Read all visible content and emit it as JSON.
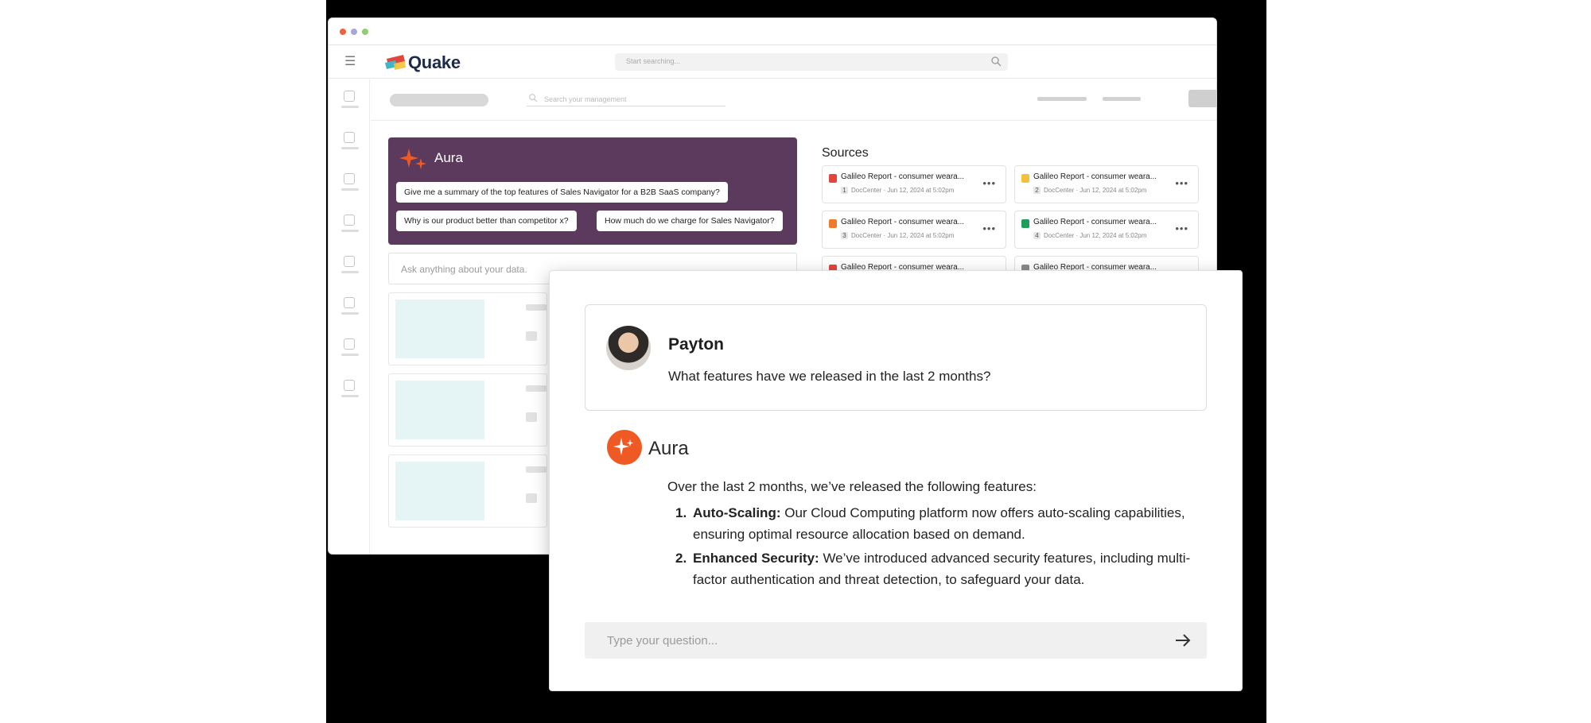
{
  "app": {
    "name": "Quake",
    "top_search_placeholder": "Start searching...",
    "sub_search_placeholder": "Search your management"
  },
  "aura_card": {
    "title": "Aura",
    "prompts": [
      "Give me a summary of the top features of Sales Navigator for a B2B SaaS company?",
      "Why is our product better than competitor x?",
      "How much do we charge for Sales Navigator?"
    ],
    "ask_placeholder": "Ask anything about your data."
  },
  "sources": {
    "title": "Sources",
    "items": [
      {
        "title": "Galileo Report - consumer weara...",
        "num": "1",
        "source": "DocCenter",
        "date": "Jun 12, 2024 at 5:02pm",
        "icon_color": "#e2463b"
      },
      {
        "title": "Galileo Report - consumer weara...",
        "num": "2",
        "source": "DocCenter",
        "date": "Jun 12, 2024 at 5:02pm",
        "icon_color": "#f3c23a"
      },
      {
        "title": "Galileo Report - consumer weara...",
        "num": "3",
        "source": "DocCenter",
        "date": "Jun 12, 2024 at 5:02pm",
        "icon_color": "#ef7a2d"
      },
      {
        "title": "Galileo Report - consumer weara...",
        "num": "4",
        "source": "DocCenter",
        "date": "Jun 12, 2024 at 5:02pm",
        "icon_color": "#1e9e5a"
      },
      {
        "title": "Galileo Report - consumer weara...",
        "icon_color": "#e2463b"
      },
      {
        "title": "Galileo Report - consumer weara...",
        "icon_color": "#8a8a8a"
      }
    ]
  },
  "chat": {
    "user_name": "Payton",
    "user_message": "What features have we released in the last 2 months?",
    "assistant_name": "Aura",
    "response_intro": "Over the last 2 months, we’ve released the following features:",
    "features": [
      {
        "number": "1.",
        "name": "Auto-Scaling:",
        "text": " Our Cloud Computing platform now offers auto-scaling capabilities, ensuring optimal resource allocation based on demand."
      },
      {
        "number": "2.",
        "name": "Enhanced Security:",
        "text": " We’ve introduced advanced security features, including multi-factor authentication and threat detection, to safeguard your data."
      }
    ],
    "input_placeholder": "Type your question..."
  },
  "icons": {
    "menu": "hamburger-icon",
    "search": "search-icon",
    "aura": "sparkle-icon",
    "send": "arrow-right-icon",
    "more": "ellipsis-icon"
  },
  "colors": {
    "aura_card_bg": "#5b3a5e",
    "aura_accent": "#ef5a24",
    "brand_text": "#1d2a4a",
    "thumb_bg": "#e5f4f4"
  }
}
